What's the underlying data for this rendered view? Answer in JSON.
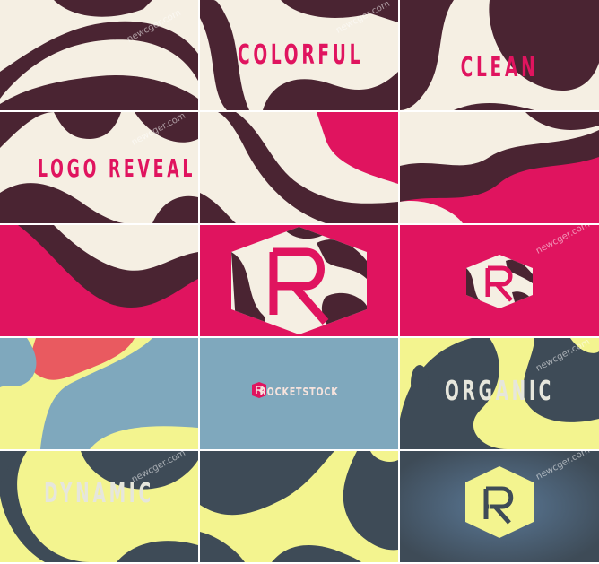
{
  "colors": {
    "cream": "#f5efe3",
    "plum": "#4a2432",
    "magenta": "#e0145f",
    "blue": "#7fa8bd",
    "yellow": "#f3f48f",
    "slate": "#3e4b57",
    "coral": "#e95a60"
  },
  "words": {
    "colorful": "COLORFUL",
    "clean": "CLEAN",
    "logo_reveal": "LOGO REVEAL",
    "organic": "ORGANIC",
    "dynamic": "DYNAMIC"
  },
  "brand": {
    "name": "ROCKETSTOCK",
    "logo_letter": "R"
  },
  "watermark": "newcger.com"
}
